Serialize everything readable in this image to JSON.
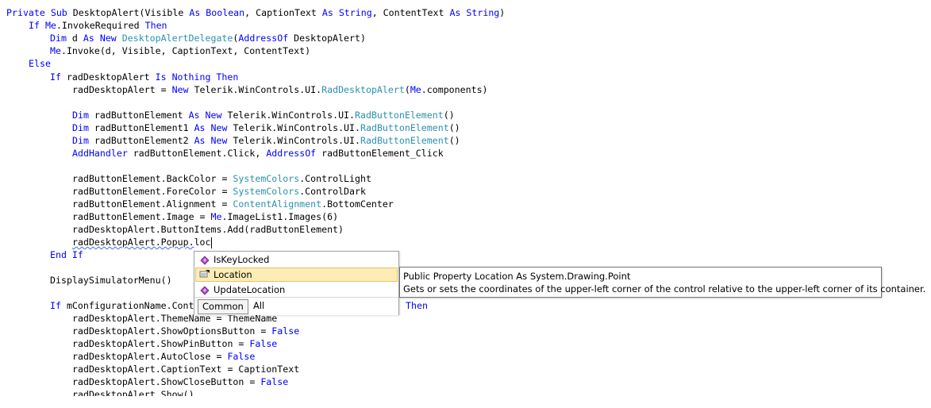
{
  "code": {
    "l1": {
      "k1": "Private Sub",
      "t1": " DesktopAlert(Visible ",
      "k2": "As Boolean",
      "t2": ", CaptionText ",
      "k3": "As String",
      "t3": ", ContentText ",
      "k4": "As String",
      "t4": ")"
    },
    "l2": {
      "k1": "If",
      "t1": " ",
      "k2": "Me",
      "t2": ".InvokeRequired ",
      "k3": "Then"
    },
    "l3": {
      "k1": "Dim",
      "t1": " d ",
      "k2": "As New",
      "t2": " ",
      "ty1": "DesktopAlertDelegate",
      "t3": "(",
      "k3": "AddressOf",
      "t4": " DesktopAlert)"
    },
    "l4": {
      "k1": "Me",
      "t1": ".Invoke(d, Visible, CaptionText, ContentText)"
    },
    "l5": {
      "k1": "Else"
    },
    "l6": {
      "k1": "If",
      "t1": " radDesktopAlert ",
      "k2": "Is Nothing Then"
    },
    "l7": {
      "t1": "radDesktopAlert = ",
      "k1": "New",
      "t2": " Telerik.WinControls.UI.",
      "ty1": "RadDesktopAlert",
      "t3": "(",
      "k2": "Me",
      "t4": ".components)"
    },
    "l8": {
      "k1": "Dim",
      "t1": " radButtonElement ",
      "k2": "As New",
      "t2": " Telerik.WinControls.UI.",
      "ty1": "RadButtonElement",
      "t3": "()"
    },
    "l9": {
      "k1": "Dim",
      "t1": " radButtonElement1 ",
      "k2": "As New",
      "t2": " Telerik.WinControls.UI.",
      "ty1": "RadButtonElement",
      "t3": "()"
    },
    "l10": {
      "k1": "Dim",
      "t1": " radButtonElement2 ",
      "k2": "As New",
      "t2": " Telerik.WinControls.UI.",
      "ty1": "RadButtonElement",
      "t3": "()"
    },
    "l11": {
      "k1": "AddHandler",
      "t1": " radButtonElement.Click, ",
      "k2": "AddressOf",
      "t2": " radButtonElement_Click"
    },
    "l12": {
      "t1": "radButtonElement.BackColor = ",
      "ty1": "SystemColors",
      "t2": ".ControlLight"
    },
    "l13": {
      "t1": "radButtonElement.ForeColor = ",
      "ty1": "SystemColors",
      "t2": ".ControlDark"
    },
    "l14": {
      "t1": "radButtonElement.Alignment = ",
      "ty1": "ContentAlignment",
      "t2": ".BottomCenter"
    },
    "l15": {
      "t1": "radButtonElement.Image = ",
      "k1": "Me",
      "t2": ".ImageList1.Images(6)"
    },
    "l16": {
      "t1": "radDesktopAlert.ButtonItems.Add(radButtonElement)"
    },
    "l17": {
      "t1": "radDesktopAlert.Popup.",
      "t2": "loc"
    },
    "l18": {
      "k1": "End If"
    },
    "l19": {
      "t1": "DisplaySimulatorMenu()"
    },
    "l20": {
      "k1": "If",
      "t1": " mConfigurationName.Cont",
      "k2": "Then"
    },
    "l21": {
      "t1": "radDesktopAlert.ThemeName = ThemeName"
    },
    "l22": {
      "t1": "radDesktopAlert.ShowOptionsButton = ",
      "k1": "False"
    },
    "l23": {
      "t1": "radDesktopAlert.ShowPinButton = ",
      "k1": "False"
    },
    "l24": {
      "t1": "radDesktopAlert.AutoClose = ",
      "k1": "False"
    },
    "l25": {
      "t1": "radDesktopAlert.CaptionText = CaptionText"
    },
    "l26": {
      "t1": "radDesktopAlert.ShowCloseButton = ",
      "k1": "False"
    },
    "l27": {
      "t1": "radDesktopAlert.Show()"
    }
  },
  "intellisense": {
    "items": [
      {
        "label": "IsKeyLocked",
        "icon": "property-icon",
        "selected": false
      },
      {
        "label": "Location",
        "icon": "property-icon",
        "selected": true
      },
      {
        "label": "UpdateLocation",
        "icon": "method-icon",
        "selected": false
      }
    ],
    "tabs": {
      "common": "Common",
      "all": "All"
    }
  },
  "tooltip": {
    "signature": "Public Property Location As System.Drawing.Point",
    "description": "Gets or sets the coordinates of the upper-left corner of the control relative to the upper-left corner of its container."
  },
  "colors": {
    "keyword": "#0000ff",
    "type": "#2b91af",
    "selection": "#fcecb6"
  }
}
